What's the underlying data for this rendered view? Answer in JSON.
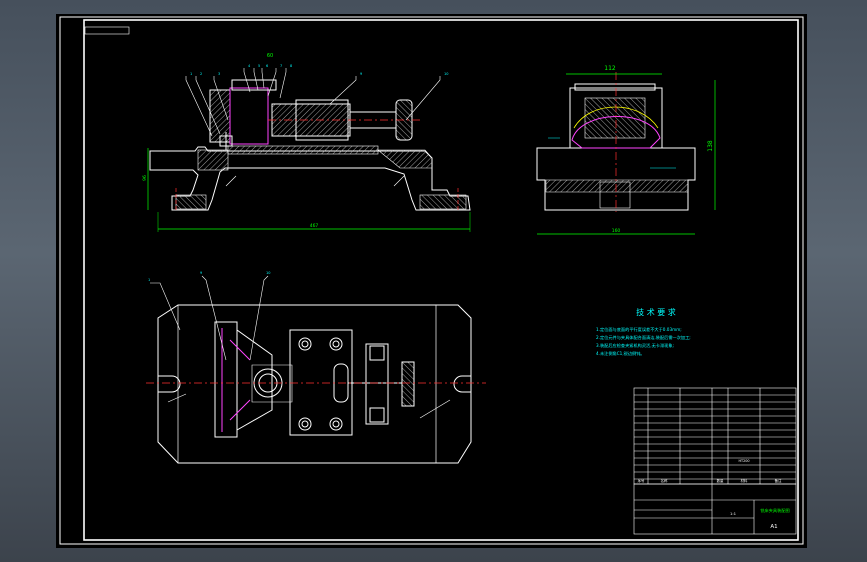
{
  "drawing": {
    "side_view_dims": {
      "width": "112",
      "height": "138",
      "depth": "160"
    },
    "front_view_dims": {
      "length": "467",
      "height": "96"
    },
    "section_mark": "60",
    "technical_requirements": {
      "title": "技 术 要 求",
      "lines": [
        "1.定位面与底面的平行度误差不大于0.03mm;",
        "2.定位元件与夹具体配合面清洁,装配后需一次加工;",
        "3.装配后应检查夹紧机构灵活,无卡滞现象;",
        "4.未注倒角C1,锐边倒钝。"
      ]
    },
    "title_block": {
      "drawing_name": "铣床夹具装配图",
      "sheet_size": "A1",
      "ratio": "1:1",
      "material": "HT200",
      "header_labels": [
        "序号",
        "名称",
        "数量",
        "材料",
        "备注"
      ]
    }
  },
  "colors": {
    "background": "#000000",
    "border": "#ffffff",
    "geometry": "#ffffff",
    "dimension": "#00ff00",
    "part": "#ff44ff",
    "leader": "#ffff00",
    "hatch": "#c8c8c8",
    "centerline": "#ff3030",
    "annotation": "#00ffff"
  }
}
